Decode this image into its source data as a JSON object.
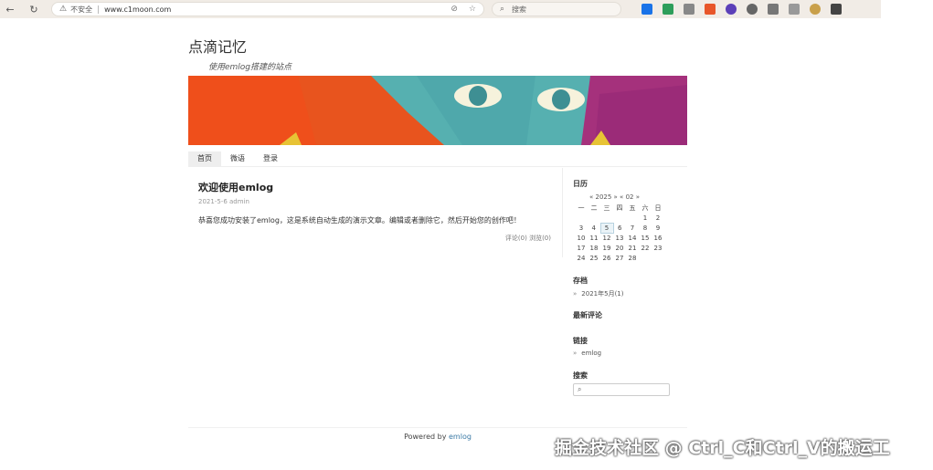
{
  "browser": {
    "insecure_label": "不安全",
    "url": "www.c1moon.com",
    "search_placeholder": "搜索"
  },
  "site": {
    "title": "点滴记忆",
    "description": "使用emlog搭建的站点"
  },
  "nav": {
    "items": [
      {
        "label": "首页"
      },
      {
        "label": "微语"
      },
      {
        "label": "登录"
      }
    ]
  },
  "post": {
    "title": "欢迎使用emlog",
    "meta": "2021-5-6 admin",
    "body": "恭喜您成功安装了emlog，这是系统自动生成的演示文章。编辑或者删除它，然后开始您的创作吧！",
    "comments": "评论(0)",
    "views": "浏览(0)"
  },
  "sidebar": {
    "calendar": {
      "title": "日历",
      "nav": "« 2025 » « 02 »",
      "weekdays": [
        "一",
        "二",
        "三",
        "四",
        "五",
        "六",
        "日"
      ],
      "rows": [
        [
          "",
          "",
          "",
          "",
          "",
          "1",
          "2"
        ],
        [
          "3",
          "4",
          "5",
          "6",
          "7",
          "8",
          "9"
        ],
        [
          "10",
          "11",
          "12",
          "13",
          "14",
          "15",
          "16"
        ],
        [
          "17",
          "18",
          "19",
          "20",
          "21",
          "22",
          "23"
        ],
        [
          "24",
          "25",
          "26",
          "27",
          "28",
          "",
          ""
        ]
      ]
    },
    "archive": {
      "title": "存档",
      "item": "2021年5月(1)"
    },
    "recent_comments": {
      "title": "最新评论"
    },
    "links": {
      "title": "链接",
      "item": "emlog"
    },
    "search": {
      "title": "搜索"
    }
  },
  "footer": {
    "powered": "Powered by",
    "link": "emlog"
  },
  "watermark": "掘金技术社区 @ Ctrl_C和Ctrl_V的搬运工",
  "colors": {
    "link": "#3b7aa6",
    "chrome_bg": "#f1ece6"
  }
}
